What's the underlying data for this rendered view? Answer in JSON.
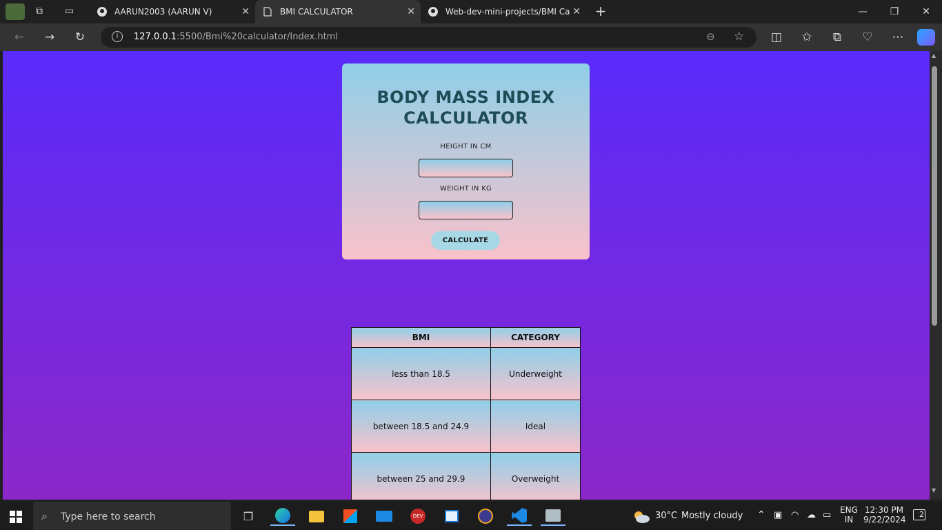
{
  "browser": {
    "tabs": [
      {
        "label": "AARUN2003 (AARUN V)"
      },
      {
        "label": "BMI CALCULATOR"
      },
      {
        "label": "Web-dev-mini-projects/BMI Calcu"
      }
    ],
    "url_host": "127.0.0.1",
    "url_rest": ":5500/Bmi%20calculator/Index.html"
  },
  "page": {
    "title_line1": "BODY MASS INDEX",
    "title_line2": "CALCULATOR",
    "height_label": "HEIGHT IN CM",
    "weight_label": "WEIGHT IN KG",
    "calculate_label": "CALCULATE",
    "table": {
      "headers": [
        "BMI",
        "CATEGORY"
      ],
      "rows": [
        [
          "less than 18.5",
          "Underweight"
        ],
        [
          "between 18.5 and 24.9",
          "Ideal"
        ],
        [
          "between 25 and 29.9",
          "Overweight"
        ]
      ]
    }
  },
  "taskbar": {
    "search_placeholder": "Type here to search",
    "weather_temp": "30°C",
    "weather_desc": "Mostly cloudy",
    "lang_line1": "ENG",
    "lang_line2": "IN",
    "time": "12:30 PM",
    "date": "9/22/2024",
    "notification_count": "2"
  },
  "colors": {
    "page_bg_top": "#5a2bfb",
    "page_bg_bottom": "#8b27c9",
    "card_top": "#8fcfe8",
    "card_bottom": "#f9c2cb",
    "title_color": "#1f4d57"
  }
}
